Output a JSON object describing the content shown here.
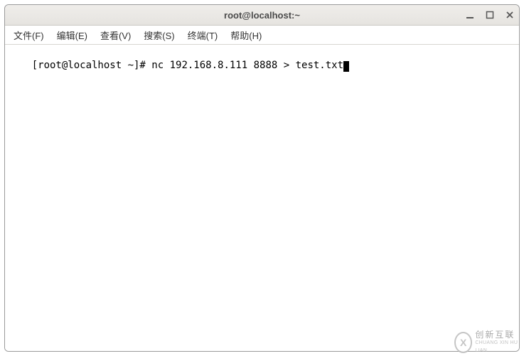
{
  "window": {
    "title": "root@localhost:~"
  },
  "menubar": {
    "file": "文件(F)",
    "edit": "编辑(E)",
    "view": "查看(V)",
    "search": "搜索(S)",
    "terminal": "终端(T)",
    "help": "帮助(H)"
  },
  "terminal": {
    "prompt": "[root@localhost ~]# ",
    "command": "nc 192.168.8.111 8888 > test.txt"
  },
  "watermark": {
    "glyph": "X",
    "zh": "创新互联",
    "en": "CHUANG XIN HU LIAN"
  }
}
